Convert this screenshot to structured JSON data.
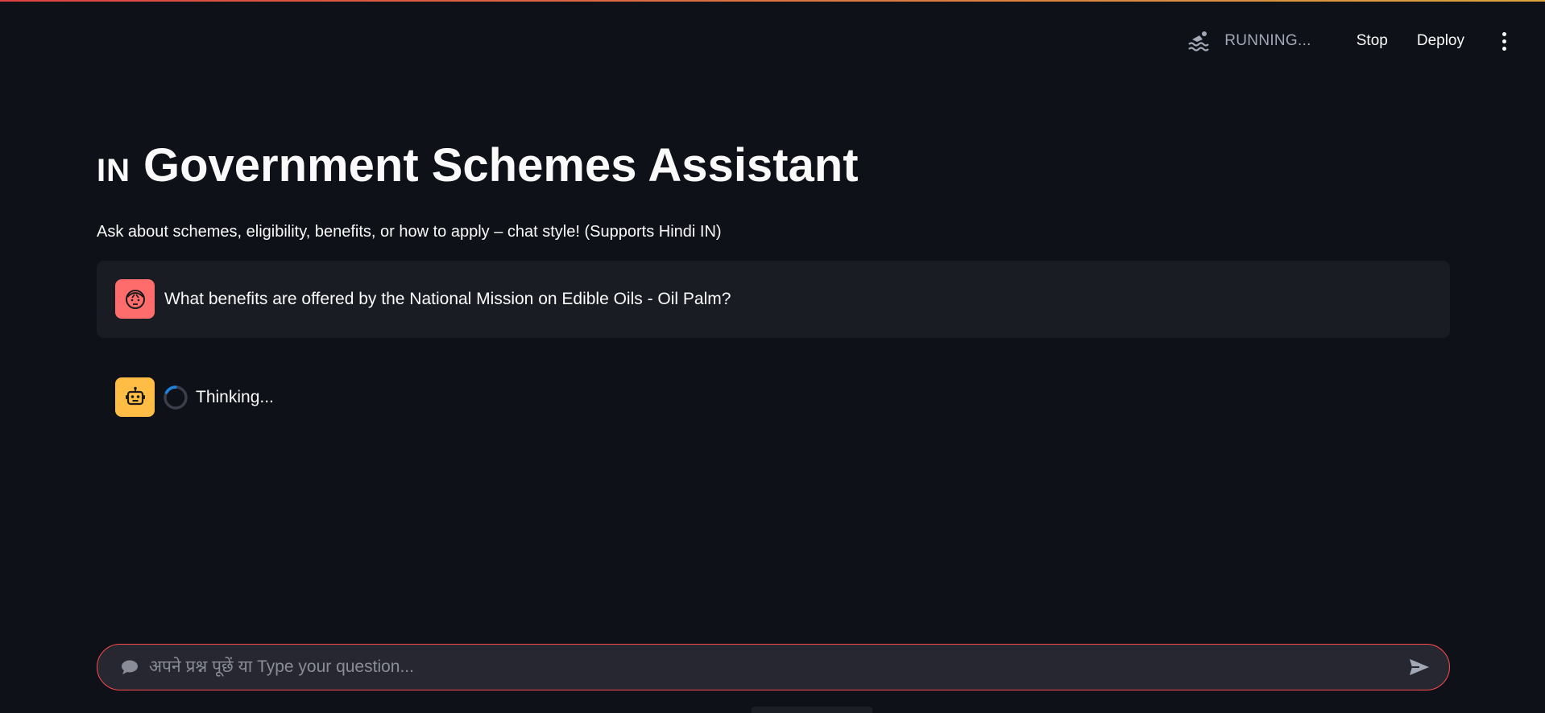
{
  "header": {
    "status_icon": "swimmer-icon",
    "status_text": "RUNNING...",
    "stop_label": "Stop",
    "deploy_label": "Deploy",
    "menu_icon": "vertical-dots-icon"
  },
  "main": {
    "title_flag": "IN",
    "title": "Government Schemes Assistant",
    "subtitle": "Ask about schemes, eligibility, benefits, or how to apply – chat style! (Supports Hindi IN)"
  },
  "chat": {
    "messages": [
      {
        "role": "user",
        "avatar_icon": "user-face-icon",
        "text": "What benefits are offered by the National Mission on Edible Oils - Oil Palm?"
      },
      {
        "role": "assistant",
        "avatar_icon": "robot-icon",
        "text": "Thinking..."
      }
    ]
  },
  "input": {
    "placeholder": "अपने प्रश्न पूछें या Type your question...",
    "icon": "speech-bubble-icon",
    "send_icon": "send-arrow-icon"
  },
  "colors": {
    "background": "#0e1117",
    "user_avatar": "#ff6c6c",
    "assistant_avatar": "#ffbd45",
    "input_border": "#ff4b4b",
    "user_bubble": "#1a1c24"
  }
}
